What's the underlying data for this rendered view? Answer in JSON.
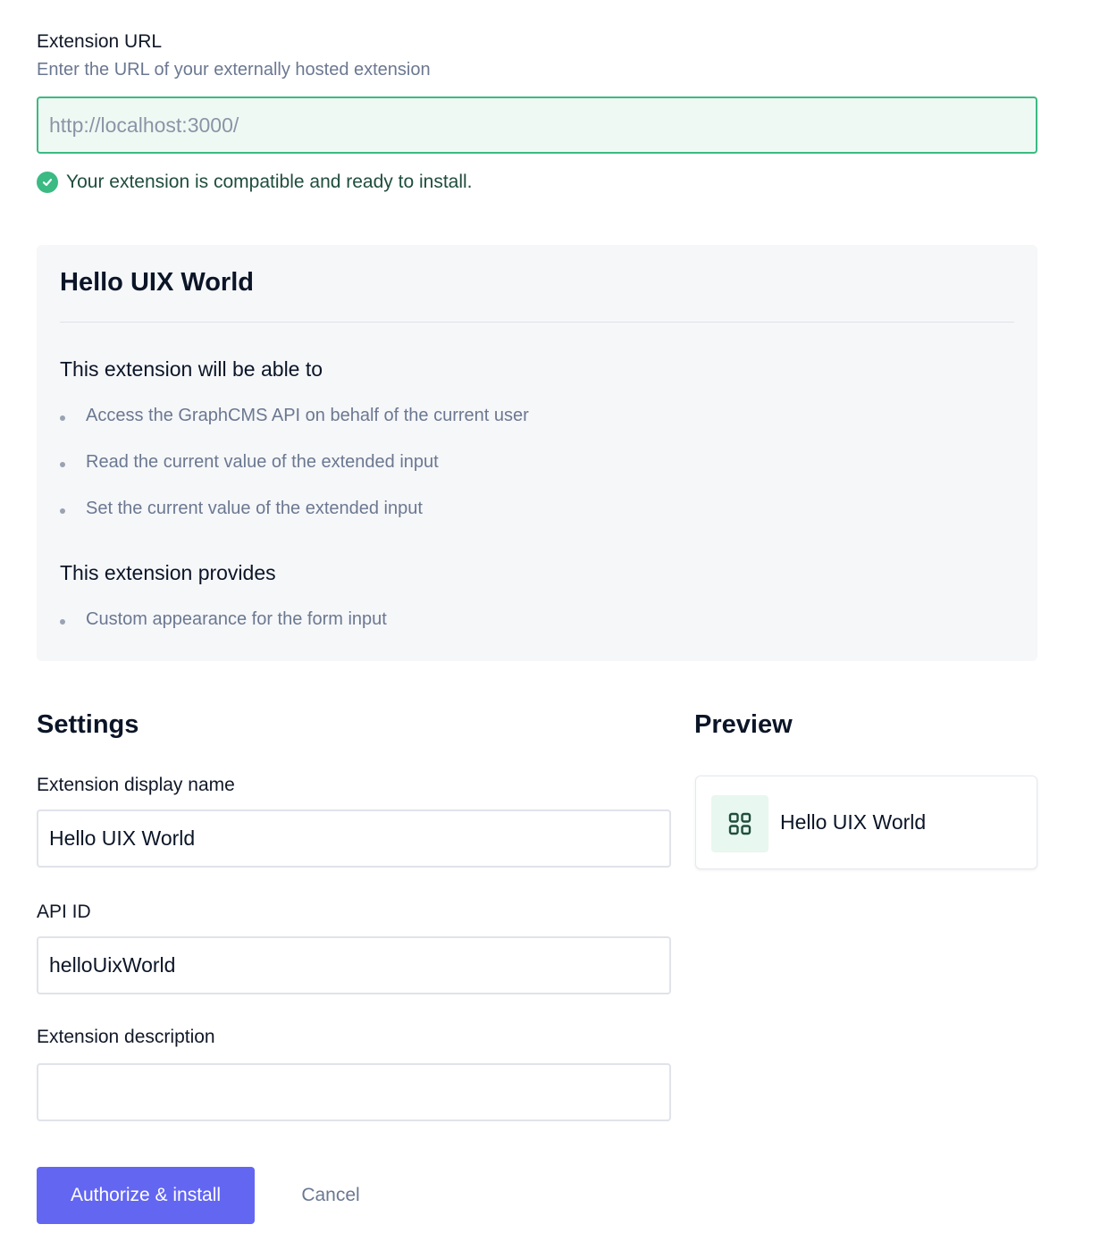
{
  "url_section": {
    "label": "Extension URL",
    "hint": "Enter the URL of your externally hosted extension",
    "placeholder": "http://localhost:3000/",
    "status_message": "Your extension is compatible and ready to install.",
    "status_icon": "check-circle-icon",
    "status_color": "#3bba83"
  },
  "extension_card": {
    "title": "Hello UIX World",
    "permissions_heading": "This extension will be able to",
    "permissions": [
      "Access the GraphCMS API on behalf of the current user",
      "Read the current value of the extended input",
      "Set the current value of the extended input"
    ],
    "provides_heading": "This extension provides",
    "provides": [
      "Custom appearance for the form input"
    ]
  },
  "settings": {
    "heading": "Settings",
    "display_name_label": "Extension display name",
    "display_name_value": "Hello UIX World",
    "api_id_label": "API ID",
    "api_id_value": "helloUixWorld",
    "description_label": "Extension description",
    "description_value": ""
  },
  "preview": {
    "heading": "Preview",
    "icon": "grid-icon",
    "name": "Hello UIX World"
  },
  "actions": {
    "primary_label": "Authorize & install",
    "secondary_label": "Cancel",
    "primary_color": "#6366f1"
  }
}
